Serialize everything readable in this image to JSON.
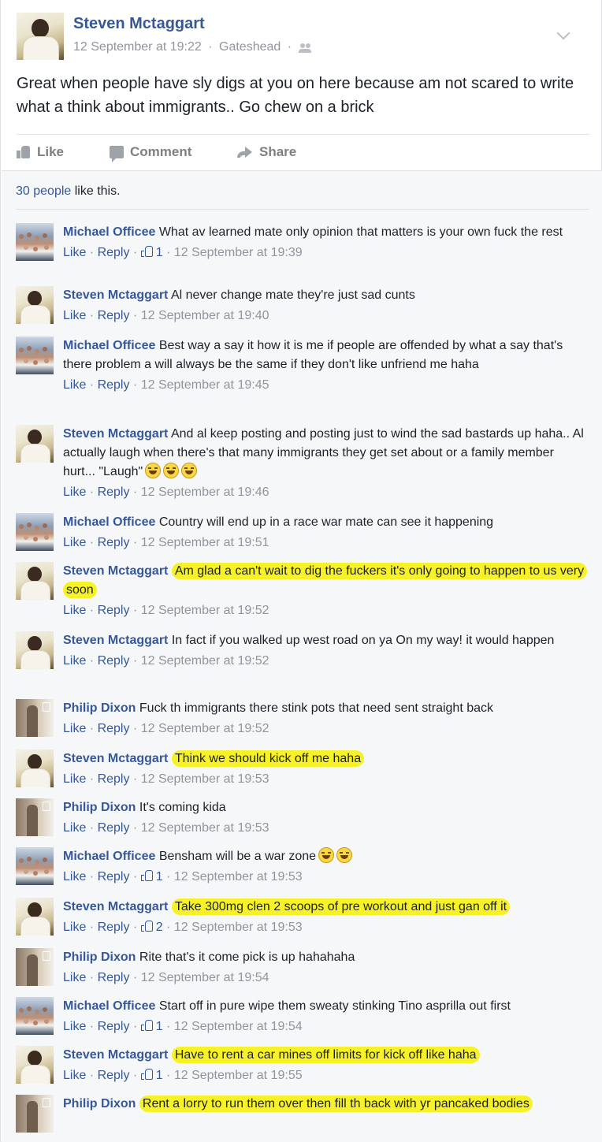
{
  "post": {
    "author": "Steven Mctaggart",
    "date": "12 September at 19:22",
    "location": "Gateshead",
    "separator": "·",
    "text": "Great when people have sly digs at you on here because am not scared to write what a think about immigrants.. Go chew on a brick",
    "actions": {
      "like": "Like",
      "comment": "Comment",
      "share": "Share"
    }
  },
  "likes": {
    "count_text": "30 people",
    "suffix": "like this."
  },
  "comments": [
    {
      "author": "Michael Officee",
      "avatar": "michael",
      "text": "What av learned mate only opinion that matters is your own fuck the rest",
      "highlight": false,
      "like": "Like",
      "reply": "Reply",
      "likes": "1",
      "time": "12 September at 19:39",
      "emoji": 0
    },
    {
      "author": "Steven Mctaggart",
      "avatar": "steven",
      "text": "Al never change mate they're just sad cunts",
      "highlight": false,
      "like": "Like",
      "reply": "Reply",
      "likes": "",
      "time": "12 September at 19:40",
      "emoji": 0
    },
    {
      "author": "Michael Officee",
      "avatar": "michael",
      "text": "Best way a say it how it is me if people are offended by what a say that's there problem a will always be the same if they don't like unfriend me haha",
      "highlight": false,
      "like": "Like",
      "reply": "Reply",
      "likes": "",
      "time": "12 September at 19:45",
      "emoji": 0
    },
    {
      "author": "Steven Mctaggart",
      "avatar": "steven",
      "text": "And al keep posting and posting just to wind the sad bastards up haha.. Al actually laugh when there's that many immigrants they get set about or a family member hurt... \"Laugh\"",
      "highlight": false,
      "like": "Like",
      "reply": "Reply",
      "likes": "",
      "time": "12 September at 19:46",
      "emoji": 3
    },
    {
      "author": "Michael Officee",
      "avatar": "michael",
      "text": "Country will end up in a race war mate can see it happening",
      "highlight": false,
      "like": "Like",
      "reply": "Reply",
      "likes": "",
      "time": "12 September at 19:51",
      "emoji": 0
    },
    {
      "author": "Steven Mctaggart",
      "avatar": "steven",
      "text": "Am glad a can't wait to dig the fuckers it's only going to happen to us very soon",
      "highlight": true,
      "like": "Like",
      "reply": "Reply",
      "likes": "",
      "time": "12 September at 19:52",
      "emoji": 0
    },
    {
      "author": "Steven Mctaggart",
      "avatar": "steven",
      "text": "In fact if you walked up west road on ya On my way! it would happen",
      "highlight": false,
      "like": "Like",
      "reply": "Reply",
      "likes": "",
      "time": "12 September at 19:52",
      "emoji": 0
    },
    {
      "author": "Philip Dixon",
      "avatar": "philip",
      "text": "Fuck th immigrants there stink pots that need sent straight back",
      "highlight": false,
      "like": "Like",
      "reply": "Reply",
      "likes": "",
      "time": "12 September at 19:52",
      "emoji": 0
    },
    {
      "author": "Steven Mctaggart",
      "avatar": "steven",
      "text": "Think we should kick off me haha",
      "highlight": true,
      "like": "Like",
      "reply": "Reply",
      "likes": "",
      "time": "12 September at 19:53",
      "emoji": 0
    },
    {
      "author": "Philip Dixon",
      "avatar": "philip",
      "text": "It's coming kida",
      "highlight": false,
      "like": "Like",
      "reply": "Reply",
      "likes": "",
      "time": "12 September at 19:53",
      "emoji": 0
    },
    {
      "author": "Michael Officee",
      "avatar": "michael",
      "text": "Bensham will be a war zone",
      "highlight": false,
      "like": "Like",
      "reply": "Reply",
      "likes": "1",
      "time": "12 September at 19:53",
      "emoji": 2
    },
    {
      "author": "Steven Mctaggart",
      "avatar": "steven",
      "text": "Take 300mg clen 2 scoops of pre workout and just gan off it",
      "highlight": true,
      "like": "Like",
      "reply": "Reply",
      "likes": "2",
      "time": "12 September at 19:53",
      "emoji": 0
    },
    {
      "author": "Philip Dixon",
      "avatar": "philip",
      "text": "Rite that's it come pick is up hahahaha",
      "highlight": false,
      "like": "Like",
      "reply": "Reply",
      "likes": "",
      "time": "12 September at 19:54",
      "emoji": 0
    },
    {
      "author": "Michael Officee",
      "avatar": "michael",
      "text": "Start off in pure wipe them sweaty stinking Tino asprilla out first",
      "highlight": false,
      "like": "Like",
      "reply": "Reply",
      "likes": "1",
      "time": "12 September at 19:54",
      "emoji": 0
    },
    {
      "author": "Steven Mctaggart",
      "avatar": "steven",
      "text": "Have to rent a car mines off limits for kick off like haha",
      "highlight": true,
      "like": "Like",
      "reply": "Reply",
      "likes": "1",
      "time": "12 September at 19:55",
      "emoji": 0
    },
    {
      "author": "Philip Dixon",
      "avatar": "philip",
      "text": "Rent a lorry to run them over then fill th back with yr pancaked bodies",
      "highlight": true,
      "like": "",
      "reply": "",
      "likes": "",
      "time": "",
      "emoji": 0
    }
  ],
  "colors": {
    "link": "#365899",
    "meta": "#90949c",
    "highlight": "#f7f227",
    "background": "#f6f7f9"
  },
  "icons": [
    "chevron-down-icon",
    "friends-icon",
    "like-icon",
    "comment-icon",
    "share-icon",
    "thumbs-up-icon",
    "laughing-emoji-icon"
  ]
}
